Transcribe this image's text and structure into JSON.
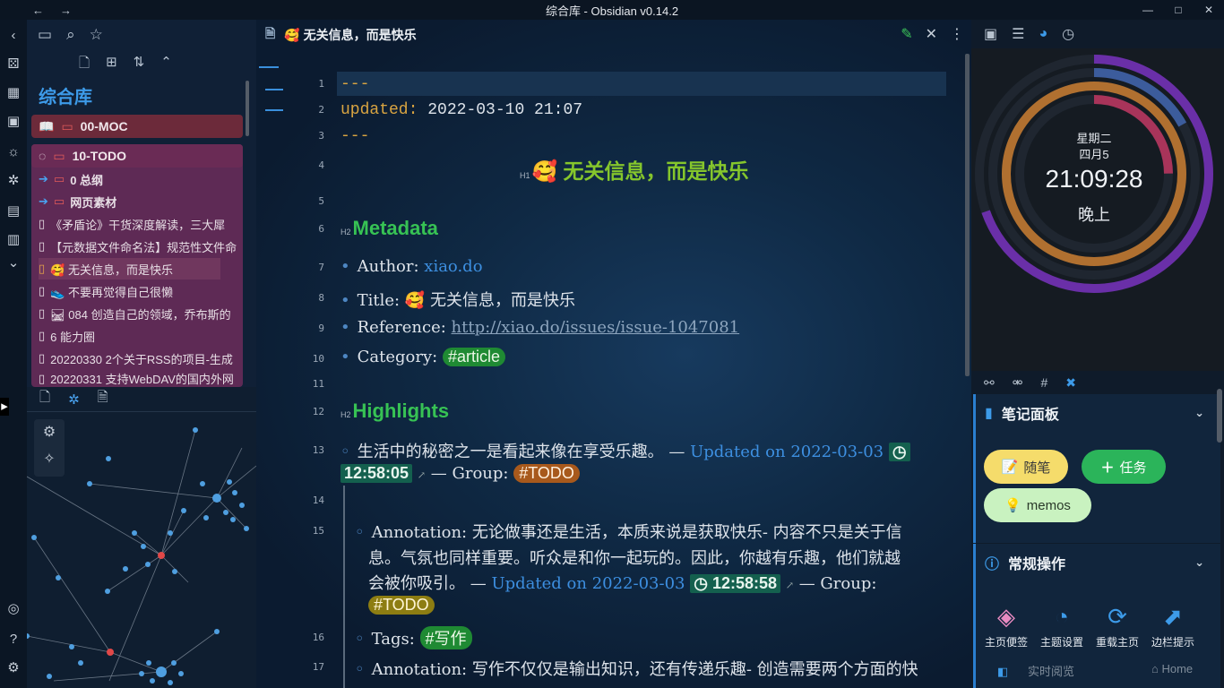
{
  "window": {
    "title": "综合库 - Obsidian v0.14.2",
    "nav_back": "←",
    "nav_forward": "→",
    "minimize": "—",
    "maximize": "□",
    "close": "✕"
  },
  "left_sidebar": {
    "vault_name": "综合库",
    "folders": [
      {
        "label": "00-MOC"
      },
      {
        "label": "10-TODO"
      }
    ],
    "items": [
      {
        "label": "0 总纲",
        "kind": "folder"
      },
      {
        "label": "网页素材",
        "kind": "folder"
      },
      {
        "label": "《矛盾论》干货深度解读，三大犀",
        "kind": "file"
      },
      {
        "label": "【元数据文件命名法】规范性文件命",
        "kind": "file"
      },
      {
        "label": "🥰 无关信息，而是快乐",
        "kind": "file"
      },
      {
        "label": "👟 不要再觉得自己很懒",
        "kind": "file"
      },
      {
        "label": "🛤 084 创造自己的领域，乔布斯的",
        "kind": "file"
      },
      {
        "label": "6 能力圈",
        "kind": "file"
      },
      {
        "label": "20220330 2个关于RSS的项目-生成",
        "kind": "file"
      },
      {
        "label": "20220331 支持WebDAV的国内外网",
        "kind": "file"
      }
    ]
  },
  "editor": {
    "tab_title": "🥰 无关信息，而是快乐",
    "lines": {
      "l1": "---",
      "l2_key": "updated:",
      "l2_val": "2022-03-10 21:07",
      "l3": "---",
      "h1_tag": "H1",
      "h1_text": "🥰 无关信息，而是快乐",
      "h2_tag": "H2",
      "metadata": "Metadata",
      "author_label": "Author:",
      "author_val": "xiao.do",
      "title_label": "Title:",
      "title_val": "🥰 无关信息，而是快乐",
      "ref_label": "Reference:",
      "ref_val": "http://xiao.do/issues/issue-1047081",
      "cat_label": "Category:",
      "cat_tag": "#article",
      "highlights": "Highlights",
      "hl1_text": "生活中的秘密之一是看起来像在享受乐趣。 —",
      "hl1_updated": "Updated on 2022-03-03",
      "hl1_time": "12:58:05",
      "hl1_group": "— Group:",
      "hl1_tag": "#TODO",
      "ann1_a": "Annotation: 无论做事还是生活，本质来说是获取快乐- 内容不只是关于信",
      "ann1_b": "息。气氛也同样重要。听众是和你一起玩的。因此，你越有乐趣，他们就越",
      "ann1_c": "会被你吸引。 —",
      "ann1_updated": "Updated on 2022-03-03",
      "ann1_time": "12:58:58",
      "ann1_group": "— Group:",
      "ann1_tag": "#TODO",
      "tags_label": "Tags:",
      "tags_tag": "#写作",
      "ann2": "Annotation: 写作不仅仅是输出知识，还有传递乐趣- 创造需要两个方面的快"
    },
    "line_numbers": [
      "1",
      "2",
      "3",
      "4",
      "5",
      "6",
      "7",
      "8",
      "9",
      "10",
      "11",
      "12",
      "13",
      "14",
      "15",
      "16",
      "17"
    ]
  },
  "right_sidebar": {
    "clock": {
      "weekday": "星期二",
      "date": "四月5",
      "time": "21:09:28",
      "period": "晚上"
    },
    "note_panel": {
      "title": "笔记面板",
      "buttons": [
        {
          "label": "随笔",
          "color": "#f5dc6b"
        },
        {
          "label": "任务",
          "color": "#2bb45a"
        },
        {
          "label": "memos",
          "color": "#c9f2c0"
        }
      ]
    },
    "ops_panel": {
      "title": "常规操作",
      "buttons": [
        {
          "label": "主页便签"
        },
        {
          "label": "主题设置"
        },
        {
          "label": "重载主页"
        },
        {
          "label": "边栏提示"
        }
      ],
      "bottom": [
        {
          "label": "实时阅览"
        },
        {
          "label": "Home"
        }
      ]
    }
  }
}
